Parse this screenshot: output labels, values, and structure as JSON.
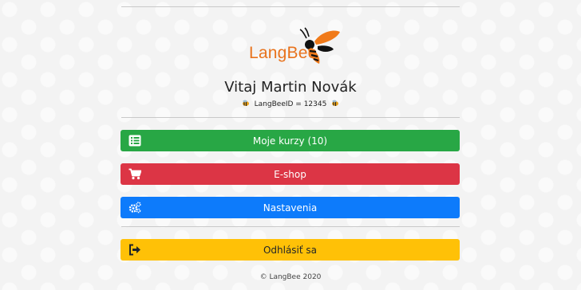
{
  "brand": {
    "logo_text": "LangBee",
    "accent": "#e8731d"
  },
  "welcome": {
    "greeting": "Vitaj",
    "name": "Martin Novák",
    "user_id_label": "LangBeeID = 12345"
  },
  "menu": {
    "courses_label": "Moje kurzy (10)",
    "shop_label": "E-shop",
    "settings_label": "Nastavenia",
    "logout_label": "Odhlásiť sa"
  },
  "colors": {
    "courses": "#28a745",
    "shop": "#dc3545",
    "settings": "#0d7bfb",
    "logout": "#ffc107"
  },
  "icons": {
    "courses": "list-icon",
    "shop": "cart-icon",
    "settings": "gears-icon",
    "logout": "sign-out-icon"
  },
  "footer": {
    "copyright": "© LangBee 2020"
  }
}
